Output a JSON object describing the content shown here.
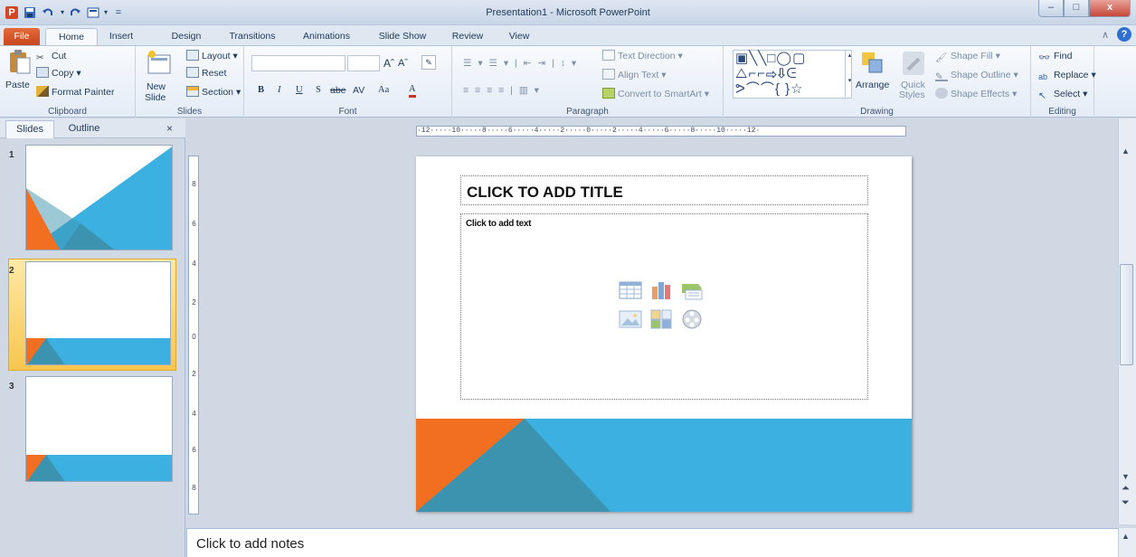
{
  "window": {
    "title": "Presentation1 - Microsoft PowerPoint",
    "minimize": "–",
    "maximize": "□",
    "close": "x"
  },
  "quick_access": {
    "logo": "P",
    "save_icon": "save-icon",
    "undo_icon": "undo-icon",
    "redo_icon": "redo-icon",
    "customize": "="
  },
  "tabs": [
    "File",
    "Home",
    "Insert",
    "Design",
    "Transitions",
    "Animations",
    "Slide Show",
    "Review",
    "View"
  ],
  "help": {
    "minimize_ribbon": "∧",
    "help": "?"
  },
  "ribbon": {
    "clipboard": {
      "label": "Clipboard",
      "paste": "Paste",
      "cut": "Cut",
      "copy": "Copy",
      "format_painter": "Format Painter"
    },
    "slides": {
      "label": "Slides",
      "new_slide_1": "New",
      "new_slide_2": "Slide",
      "layout": "Layout",
      "reset": "Reset",
      "section": "Section"
    },
    "font": {
      "label": "Font",
      "bold": "B",
      "italic": "I",
      "underline": "U",
      "shadow": "S",
      "strikethrough": "abe",
      "spacing": "AV",
      "change_case": "Aa",
      "grow": "Aˆ",
      "shrink": "Aˇ",
      "font_color": "A"
    },
    "paragraph": {
      "label": "Paragraph",
      "text_direction": "Text Direction",
      "align_text": "Align Text",
      "convert_smartart": "Convert to SmartArt"
    },
    "drawing": {
      "label": "Drawing",
      "arrange": "Arrange",
      "quick_styles_1": "Quick",
      "quick_styles_2": "Styles",
      "shape_fill": "Shape Fill",
      "shape_outline": "Shape Outline",
      "shape_effects": "Shape Effects"
    },
    "editing": {
      "label": "Editing",
      "find": "Find",
      "replace": "Replace",
      "select": "Select"
    }
  },
  "slides_pane": {
    "tab_slides": "Slides",
    "tab_outline": "Outline",
    "close": "×",
    "thumbnails": [
      {
        "number": "1",
        "selected": false
      },
      {
        "number": "2",
        "selected": true
      },
      {
        "number": "3",
        "selected": false
      }
    ]
  },
  "ruler": {
    "horizontal": "·12·····10·····8·····6·····4·····2·····0·····2·····4·····6·····8·····10·····12·",
    "vertical": [
      "8",
      "6",
      "4",
      "2",
      "0",
      "2",
      "4",
      "6",
      "8"
    ]
  },
  "slide": {
    "title_placeholder": "CLICK TO ADD TITLE",
    "body_placeholder": "Click to add text",
    "colors": {
      "orange": "#f26f21",
      "blue": "#3cb0e0",
      "dark_blue": "#3b93b0"
    }
  },
  "notes": {
    "placeholder": "Click to add notes"
  }
}
